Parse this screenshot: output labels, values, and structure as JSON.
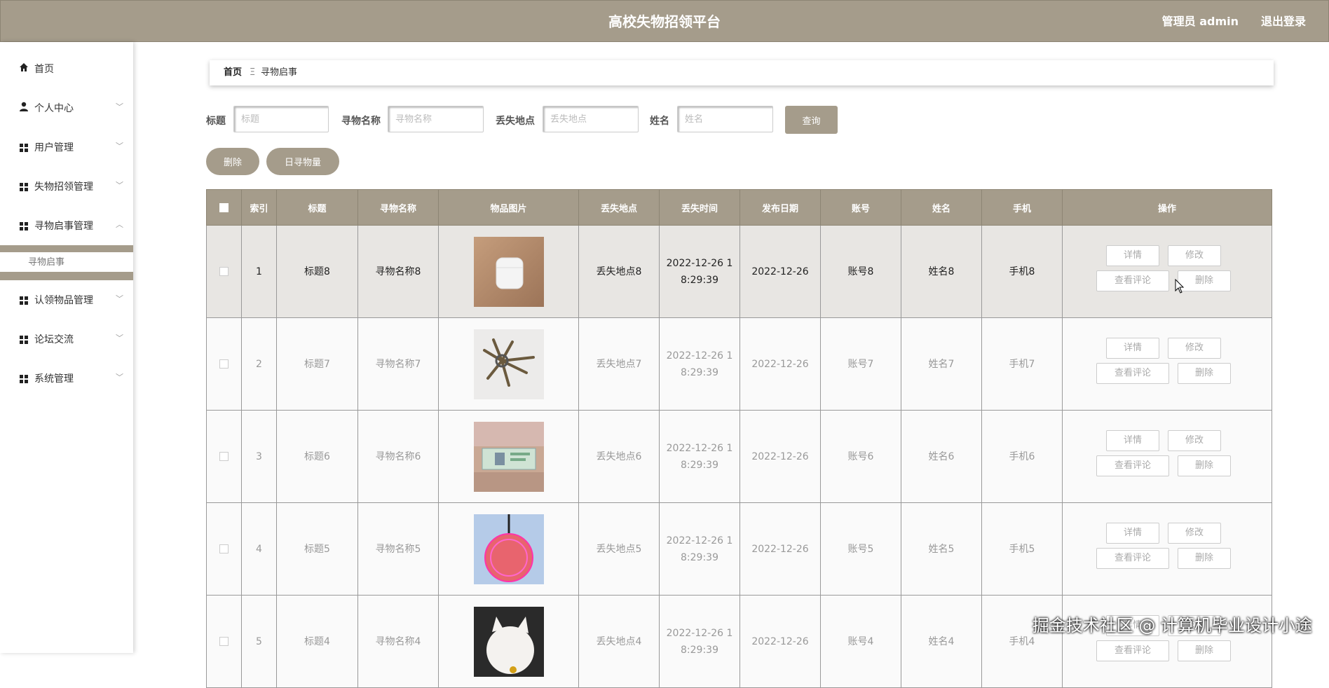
{
  "header": {
    "title": "高校失物招领平台",
    "admin_label": "管理员 admin",
    "logout_label": "退出登录",
    "bg_color": "#a59c8b"
  },
  "sidebar": {
    "items": [
      {
        "label": "首页",
        "icon": "home-icon",
        "chevron": ""
      },
      {
        "label": "个人中心",
        "icon": "user-icon",
        "chevron": "﹀"
      },
      {
        "label": "用户管理",
        "icon": "grid-icon",
        "chevron": "﹀"
      },
      {
        "label": "失物招领管理",
        "icon": "grid-icon",
        "chevron": "﹀"
      },
      {
        "label": "寻物启事管理",
        "icon": "grid-icon",
        "chevron": "︿"
      },
      {
        "label": "认领物品管理",
        "icon": "grid-icon",
        "chevron": "﹀"
      },
      {
        "label": "论坛交流",
        "icon": "grid-icon",
        "chevron": "﹀"
      },
      {
        "label": "系统管理",
        "icon": "grid-icon",
        "chevron": "﹀"
      }
    ],
    "sub_item": "寻物启事"
  },
  "breadcrumb": {
    "home": "首页",
    "separator": "Ξ",
    "current": "寻物启事"
  },
  "search": {
    "title_label": "标题",
    "title_placeholder": "标题",
    "name_label": "寻物名称",
    "name_placeholder": "寻物名称",
    "place_label": "丢失地点",
    "place_placeholder": "丢失地点",
    "person_label": "姓名",
    "person_placeholder": "姓名",
    "query_button": "查询"
  },
  "actions": {
    "delete_button": "删除",
    "daily_button": "日寻物量"
  },
  "table": {
    "headers": [
      "",
      "索引",
      "标题",
      "寻物名称",
      "物品图片",
      "丢失地点",
      "丢失时间",
      "发布日期",
      "账号",
      "姓名",
      "手机",
      "操作"
    ],
    "op_labels": {
      "detail": "详情",
      "edit": "修改",
      "comments": "查看评论",
      "delete": "删除"
    },
    "rows": [
      {
        "index": "1",
        "title": "标题8",
        "name": "寻物名称8",
        "image": "earbuds-case-photo",
        "place": "丢失地点8",
        "time": "2022-12-26 18:29:39",
        "date": "2022-12-26",
        "account": "账号8",
        "person": "姓名8",
        "phone": "手机8"
      },
      {
        "index": "2",
        "title": "标题7",
        "name": "寻物名称7",
        "image": "keys-photo",
        "place": "丢失地点7",
        "time": "2022-12-26 18:29:39",
        "date": "2022-12-26",
        "account": "账号7",
        "person": "姓名7",
        "phone": "手机7"
      },
      {
        "index": "3",
        "title": "标题6",
        "name": "寻物名称6",
        "image": "id-card-photo",
        "place": "丢失地点6",
        "time": "2022-12-26 18:29:39",
        "date": "2022-12-26",
        "account": "账号6",
        "person": "姓名6",
        "phone": "手机6"
      },
      {
        "index": "4",
        "title": "标题5",
        "name": "寻物名称5",
        "image": "pendant-photo",
        "place": "丢失地点5",
        "time": "2022-12-26 18:29:39",
        "date": "2022-12-26",
        "account": "账号5",
        "person": "姓名5",
        "phone": "手机5"
      },
      {
        "index": "5",
        "title": "标题4",
        "name": "寻物名称4",
        "image": "cat-photo",
        "place": "丢失地点4",
        "time": "2022-12-26 18:29:39",
        "date": "2022-12-26",
        "account": "账号4",
        "person": "姓名4",
        "phone": "手机4"
      }
    ]
  },
  "watermark": "掘金技术社区 @ 计算机毕业设计小途"
}
